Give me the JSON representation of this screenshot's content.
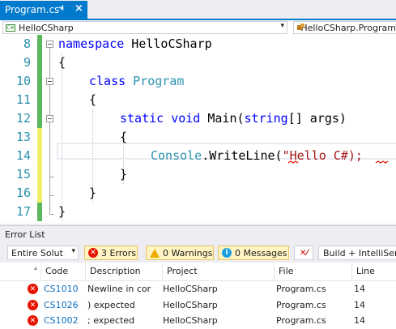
{
  "tab": {
    "title": "Program.cs*",
    "pin_icon": "pin-icon",
    "close_icon": "close-icon"
  },
  "navbar": {
    "project": "HelloCSharp",
    "class_path": "HelloCSharp.Program"
  },
  "editor": {
    "lines": [
      {
        "num": "8"
      },
      {
        "num": "9"
      },
      {
        "num": "10"
      },
      {
        "num": "11"
      },
      {
        "num": "12"
      },
      {
        "num": "13"
      },
      {
        "num": "14"
      },
      {
        "num": "15"
      },
      {
        "num": "16"
      },
      {
        "num": "17"
      }
    ],
    "l8_kw": "namespace",
    "l8_name": " HelloCSharp",
    "l9": "{",
    "l10_kw": "class",
    "l10_type": " Program",
    "l11": "{",
    "l12_kw1": "static",
    "l12_kw2": " void",
    "l12_name": " Main(",
    "l12_kw3": "string",
    "l12_rest": "[] args)",
    "l13": "{",
    "l14_type": "Console",
    "l14_mid": ".WriteLine(",
    "l14_str": "\"Hello C#);",
    "l15": "}",
    "l16": "}",
    "l17": "}"
  },
  "error_list": {
    "title": "Error List",
    "scope": "Entire Solut",
    "errors_btn": "3 Errors",
    "warnings_btn": "0 Warnings",
    "messages_btn": "0 Messages",
    "build_filter": "Build + IntelliSense",
    "columns": {
      "code": "Code",
      "description": "Description",
      "project": "Project",
      "file": "File",
      "line": "Line"
    },
    "rows": [
      {
        "code": "CS1010",
        "description": "Newline in cor",
        "project": "HelloCSharp",
        "file": "Program.cs",
        "line": "14"
      },
      {
        "code": "CS1026",
        "description": ") expected",
        "project": "HelloCSharp",
        "file": "Program.cs",
        "line": "14"
      },
      {
        "code": "CS1002",
        "description": "; expected",
        "project": "HelloCSharp",
        "file": "Program.cs",
        "line": "14"
      }
    ]
  },
  "colors": {
    "accent": "#007acc",
    "keyword": "#0000ff",
    "type": "#2b91af",
    "string": "#a31515",
    "error": "#e51400"
  }
}
